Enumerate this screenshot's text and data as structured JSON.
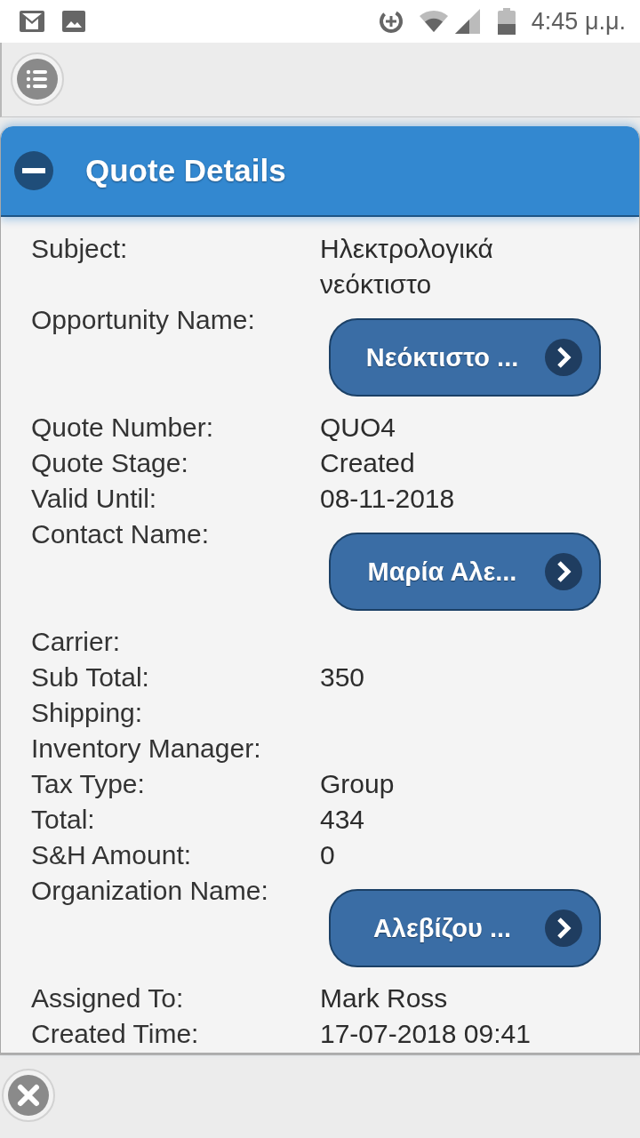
{
  "status_bar": {
    "time": "4:45 μ.μ."
  },
  "panel": {
    "title": "Quote Details",
    "expanded": true
  },
  "fields": [
    {
      "label": "Subject:",
      "kind": "text",
      "value": "Ηλεκτρολογικά νεόκτιστο"
    },
    {
      "label": "Opportunity Name:",
      "kind": "link",
      "value": "Νεόκτιστο ..."
    },
    {
      "label": "Quote Number:",
      "kind": "text",
      "value": "QUO4"
    },
    {
      "label": "Quote Stage:",
      "kind": "text",
      "value": "Created"
    },
    {
      "label": "Valid Until:",
      "kind": "text",
      "value": "08-11-2018"
    },
    {
      "label": "Contact Name:",
      "kind": "link",
      "value": "Μαρία Αλε..."
    },
    {
      "label": "Carrier:",
      "kind": "text"
    },
    {
      "label": "Sub Total:",
      "kind": "text",
      "value": "350"
    },
    {
      "label": "Shipping:",
      "kind": "text"
    },
    {
      "label": "Inventory Manager:",
      "kind": "text"
    },
    {
      "label": "Tax Type:",
      "kind": "text",
      "value": "Group"
    },
    {
      "label": "Total:",
      "kind": "text",
      "value": "434"
    },
    {
      "label": "S&H Amount:",
      "kind": "text",
      "value": "0"
    },
    {
      "label": "Organization Name:",
      "kind": "link",
      "value": "Αλεβίζου ..."
    },
    {
      "label": "Assigned To:",
      "kind": "text",
      "value": "Mark Ross"
    },
    {
      "label": "Created Time:",
      "kind": "text",
      "value": "17-07-2018 09:41"
    }
  ]
}
